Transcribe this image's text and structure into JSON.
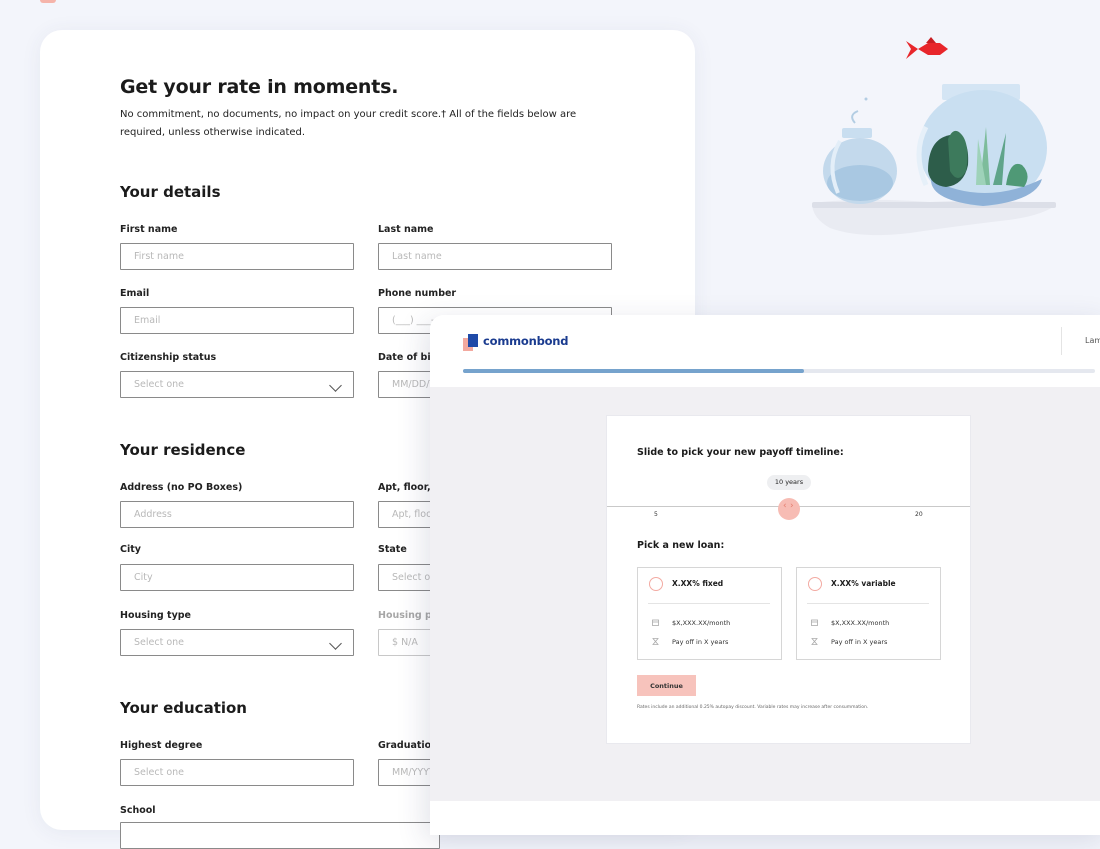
{
  "form": {
    "title": "Get your rate in moments.",
    "subtitle": "No commitment, no documents, no impact on your credit score.† All of the fields below are required, unless otherwise indicated.",
    "sections": {
      "details": "Your details",
      "residence": "Your residence",
      "education": "Your education"
    },
    "fields": {
      "first_name": {
        "label": "First name",
        "placeholder": "First name"
      },
      "last_name": {
        "label": "Last name",
        "placeholder": "Last name"
      },
      "email": {
        "label": "Email",
        "placeholder": "Email"
      },
      "phone": {
        "label": "Phone number",
        "placeholder": "(___) ___-____"
      },
      "citizenship": {
        "label": "Citizenship status",
        "placeholder": "Select one"
      },
      "dob": {
        "label": "Date of birth",
        "placeholder": "MM/DD/YYYY"
      },
      "address": {
        "label": "Address (no PO Boxes)",
        "placeholder": "Address"
      },
      "apt": {
        "label": "Apt, floor, etc. (optional)",
        "placeholder": "Apt, floor, etc."
      },
      "city": {
        "label": "City",
        "placeholder": "City"
      },
      "state": {
        "label": "State",
        "placeholder": "Select one"
      },
      "housing_type": {
        "label": "Housing type",
        "placeholder": "Select one"
      },
      "housing_payment": {
        "label": "Housing payment",
        "placeholder": "$  N/A"
      },
      "degree": {
        "label": "Highest degree",
        "placeholder": "Select one"
      },
      "graduation": {
        "label": "Graduation date",
        "placeholder": "MM/YYYY"
      },
      "school": {
        "label": "School"
      }
    }
  },
  "app": {
    "brand": "commonbond",
    "user": "Lamar",
    "progress": 0.54,
    "slider": {
      "title": "Slide to pick your new payoff timeline:",
      "value_label": "10 years",
      "value": 10,
      "min": 5,
      "max": 20,
      "min_label": "5",
      "max_label": "20"
    },
    "loan_title": "Pick a new loan:",
    "options": [
      {
        "title": "X.XX% fixed",
        "monthly": "$X,XXX.XX/month",
        "payoff": "Pay off in X years"
      },
      {
        "title": "X.XX% variable",
        "monthly": "$X,XXX.XX/month",
        "payoff": "Pay off in X years"
      }
    ],
    "continue_label": "Continue",
    "disclaimer": "Rates include an additional 0.25% autopay discount. Variable rates may increase after consummation."
  },
  "colors": {
    "accent_pink": "#f7c3bc",
    "brand_blue": "#1a3b8f",
    "progress_blue": "#76a3cd",
    "page_bg": "#f3f5fb"
  }
}
